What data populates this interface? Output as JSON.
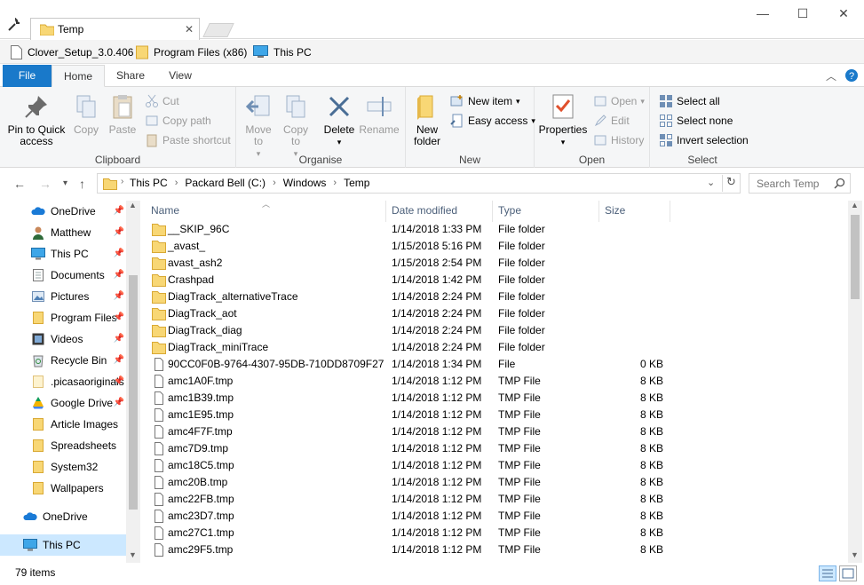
{
  "window": {
    "tab_title": "Temp",
    "close_tab": "✕",
    "minimize": "—",
    "maximize": "☐",
    "close": "✕"
  },
  "bookmarks": [
    {
      "label": "Clover_Setup_3.0.406",
      "icon": "file-icon"
    },
    {
      "label": "Program Files (x86)",
      "icon": "folder-icon"
    },
    {
      "label": "This PC",
      "icon": "computer-icon"
    }
  ],
  "ribbon_tabs": {
    "file": "File",
    "home": "Home",
    "share": "Share",
    "view": "View"
  },
  "ribbon": {
    "clipboard": {
      "label": "Clipboard",
      "pin": "Pin to Quick access",
      "copy": "Copy",
      "paste": "Paste",
      "cut": "Cut",
      "copy_path": "Copy path",
      "paste_shortcut": "Paste shortcut"
    },
    "organise": {
      "label": "Organise",
      "move_to": "Move to",
      "copy_to": "Copy to",
      "delete": "Delete",
      "rename": "Rename"
    },
    "new": {
      "label": "New",
      "new_folder": "New folder",
      "new_item": "New item",
      "easy_access": "Easy access"
    },
    "open": {
      "label": "Open",
      "properties": "Properties",
      "open": "Open",
      "edit": "Edit",
      "history": "History"
    },
    "select": {
      "label": "Select",
      "select_all": "Select all",
      "select_none": "Select none",
      "invert": "Invert selection"
    }
  },
  "address": {
    "crumbs": [
      "This PC",
      "Packard Bell (C:)",
      "Windows",
      "Temp"
    ],
    "search_placeholder": "Search Temp"
  },
  "nav": [
    {
      "label": "OneDrive",
      "icon": "cloud-icon",
      "pinned": true
    },
    {
      "label": "Matthew",
      "icon": "user-icon",
      "pinned": true
    },
    {
      "label": "This PC",
      "icon": "computer-icon",
      "pinned": true
    },
    {
      "label": "Documents",
      "icon": "documents-icon",
      "pinned": true
    },
    {
      "label": "Pictures",
      "icon": "pictures-icon",
      "pinned": true
    },
    {
      "label": "Program Files",
      "icon": "folder-icon",
      "pinned": true
    },
    {
      "label": "Videos",
      "icon": "videos-icon",
      "pinned": true
    },
    {
      "label": "Recycle Bin",
      "icon": "recycle-bin-icon",
      "pinned": true
    },
    {
      "label": ".picasaoriginals",
      "icon": "folder-icon",
      "pinned": true
    },
    {
      "label": "Google Drive",
      "icon": "google-drive-icon",
      "pinned": true
    },
    {
      "label": "Article Images",
      "icon": "folder-icon",
      "pinned": false
    },
    {
      "label": "Spreadsheets",
      "icon": "folder-icon",
      "pinned": false
    },
    {
      "label": "System32",
      "icon": "folder-icon",
      "pinned": false
    },
    {
      "label": "Wallpapers",
      "icon": "folder-icon",
      "pinned": false
    },
    {
      "label": "OneDrive",
      "icon": "cloud-icon",
      "pinned": false
    },
    {
      "label": "This PC",
      "icon": "computer-icon",
      "pinned": false
    }
  ],
  "columns": {
    "name": "Name",
    "date": "Date modified",
    "type": "Type",
    "size": "Size"
  },
  "files": [
    {
      "name": "__SKIP_96C",
      "date": "1/14/2018 1:33 PM",
      "type": "File folder",
      "size": "",
      "kind": "folder"
    },
    {
      "name": "_avast_",
      "date": "1/15/2018 5:16 PM",
      "type": "File folder",
      "size": "",
      "kind": "folder"
    },
    {
      "name": "avast_ash2",
      "date": "1/15/2018 2:54 PM",
      "type": "File folder",
      "size": "",
      "kind": "folder"
    },
    {
      "name": "Crashpad",
      "date": "1/14/2018 1:42 PM",
      "type": "File folder",
      "size": "",
      "kind": "folder"
    },
    {
      "name": "DiagTrack_alternativeTrace",
      "date": "1/14/2018 2:24 PM",
      "type": "File folder",
      "size": "",
      "kind": "folder"
    },
    {
      "name": "DiagTrack_aot",
      "date": "1/14/2018 2:24 PM",
      "type": "File folder",
      "size": "",
      "kind": "folder"
    },
    {
      "name": "DiagTrack_diag",
      "date": "1/14/2018 2:24 PM",
      "type": "File folder",
      "size": "",
      "kind": "folder"
    },
    {
      "name": "DiagTrack_miniTrace",
      "date": "1/14/2018 2:24 PM",
      "type": "File folder",
      "size": "",
      "kind": "folder"
    },
    {
      "name": "90CC0F0B-9764-4307-95DB-710DD8709F27",
      "date": "1/14/2018 1:34 PM",
      "type": "File",
      "size": "0 KB",
      "kind": "file"
    },
    {
      "name": "amc1A0F.tmp",
      "date": "1/14/2018 1:12 PM",
      "type": "TMP File",
      "size": "8 KB",
      "kind": "file"
    },
    {
      "name": "amc1B39.tmp",
      "date": "1/14/2018 1:12 PM",
      "type": "TMP File",
      "size": "8 KB",
      "kind": "file"
    },
    {
      "name": "amc1E95.tmp",
      "date": "1/14/2018 1:12 PM",
      "type": "TMP File",
      "size": "8 KB",
      "kind": "file"
    },
    {
      "name": "amc4F7F.tmp",
      "date": "1/14/2018 1:12 PM",
      "type": "TMP File",
      "size": "8 KB",
      "kind": "file"
    },
    {
      "name": "amc7D9.tmp",
      "date": "1/14/2018 1:12 PM",
      "type": "TMP File",
      "size": "8 KB",
      "kind": "file"
    },
    {
      "name": "amc18C5.tmp",
      "date": "1/14/2018 1:12 PM",
      "type": "TMP File",
      "size": "8 KB",
      "kind": "file"
    },
    {
      "name": "amc20B.tmp",
      "date": "1/14/2018 1:12 PM",
      "type": "TMP File",
      "size": "8 KB",
      "kind": "file"
    },
    {
      "name": "amc22FB.tmp",
      "date": "1/14/2018 1:12 PM",
      "type": "TMP File",
      "size": "8 KB",
      "kind": "file"
    },
    {
      "name": "amc23D7.tmp",
      "date": "1/14/2018 1:12 PM",
      "type": "TMP File",
      "size": "8 KB",
      "kind": "file"
    },
    {
      "name": "amc27C1.tmp",
      "date": "1/14/2018 1:12 PM",
      "type": "TMP File",
      "size": "8 KB",
      "kind": "file"
    },
    {
      "name": "amc29F5.tmp",
      "date": "1/14/2018 1:12 PM",
      "type": "TMP File",
      "size": "8 KB",
      "kind": "file"
    }
  ],
  "status": {
    "item_count": "79 items"
  },
  "colors": {
    "accent": "#1979ca",
    "folder": "#f8d775",
    "selection": "#cce8ff"
  }
}
